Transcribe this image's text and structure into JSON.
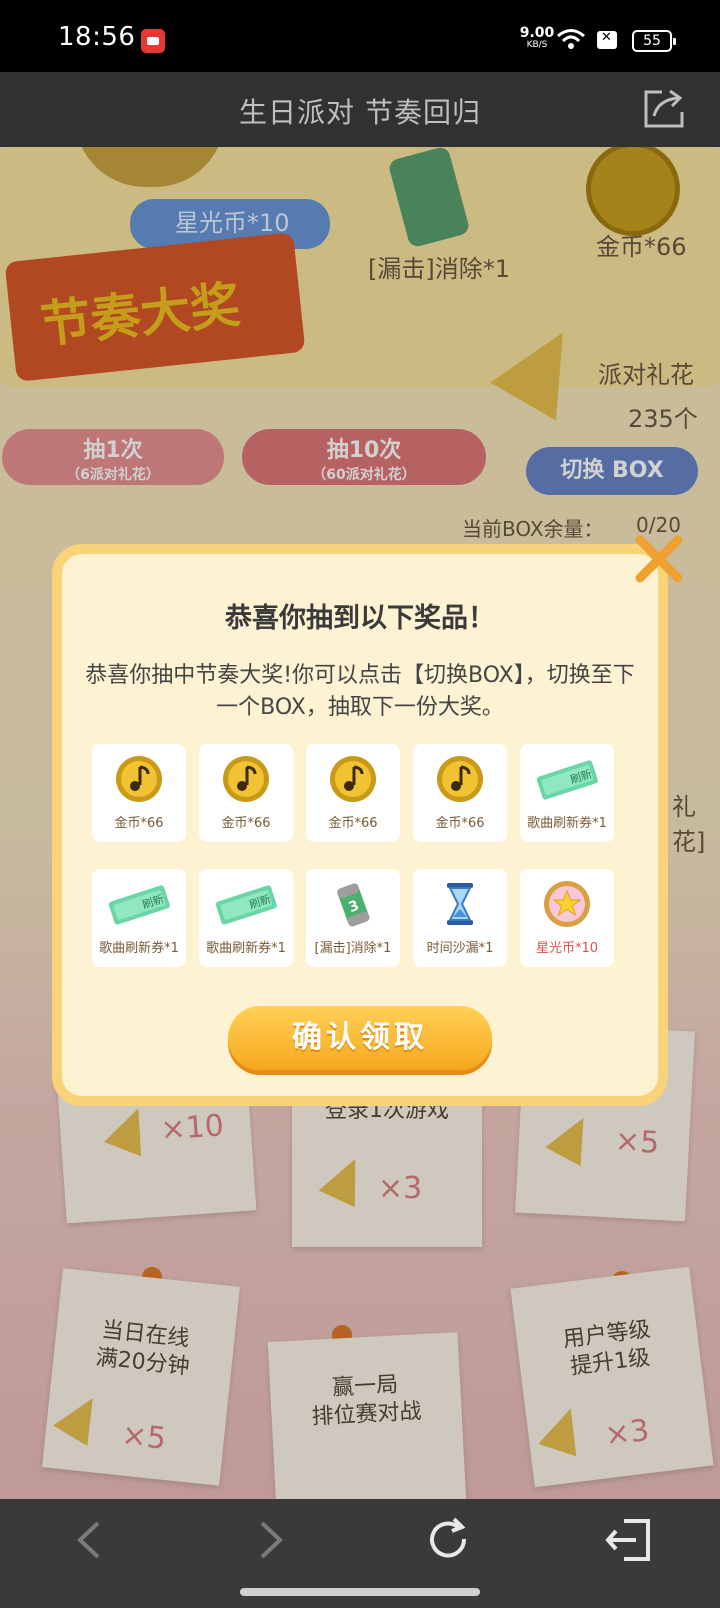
{
  "status_bar": {
    "time": "18:56",
    "net_speed_value": "9.00",
    "net_speed_unit": "KB/S",
    "battery": "55"
  },
  "header": {
    "title": "生日派对 节奏回归"
  },
  "background": {
    "star_coin": "星光币*10",
    "miss_clear": "[漏击]消除*1",
    "gold_coin": "金币*66",
    "grand_prize": "节奏大奖",
    "party_popper_label": "派对礼花",
    "party_popper_count": "235个",
    "draw_once": "抽1次",
    "draw_once_cost": "（6派对礼花）",
    "draw_ten": "抽10次",
    "draw_ten_cost": "（60派对礼花）",
    "switch_box": "切换 BOX",
    "box_remaining_label": "当前BOX余量：",
    "box_remaining_value": "0/20",
    "side_fragment": "礼花]",
    "task_fragment": "派对",
    "task_login": "登录1次游戏",
    "task_online": "当日在线\n满20分钟",
    "task_ranked": "赢一局\n排位赛对战",
    "task_level": "用户等级\n提升1级",
    "mult_10": "×10",
    "mult_5a": "×5",
    "mult_3a": "×3",
    "mult_5b": "×5",
    "mult_3b": "×3"
  },
  "dialog": {
    "title": "恭喜你抽到以下奖品！",
    "description": "恭喜你抽中节奏大奖!你可以点击【切换BOX】，切换至下一个BOX，抽取下一份大奖。",
    "confirm_label": "确认领取",
    "prizes": [
      {
        "label": "金币*66",
        "icon": "gold-coin-icon"
      },
      {
        "label": "金币*66",
        "icon": "gold-coin-icon"
      },
      {
        "label": "金币*66",
        "icon": "gold-coin-icon"
      },
      {
        "label": "金币*66",
        "icon": "gold-coin-icon"
      },
      {
        "label": "歌曲刷新券*1",
        "icon": "refresh-ticket-icon"
      },
      {
        "label": "歌曲刷新券*1",
        "icon": "refresh-ticket-icon"
      },
      {
        "label": "歌曲刷新券*1",
        "icon": "refresh-ticket-icon"
      },
      {
        "label": "[漏击]消除*1",
        "icon": "miss-clear-battery-icon"
      },
      {
        "label": "时间沙漏*1",
        "icon": "hourglass-icon"
      },
      {
        "label": "星光币*10",
        "icon": "star-coin-icon"
      }
    ],
    "ticket_text": "刷新"
  },
  "colors": {
    "dialog_bg": "#fdf2d2",
    "dialog_border": "#f8d37a",
    "confirm_button": "#f7a81d",
    "close_x": "#f0a030"
  }
}
